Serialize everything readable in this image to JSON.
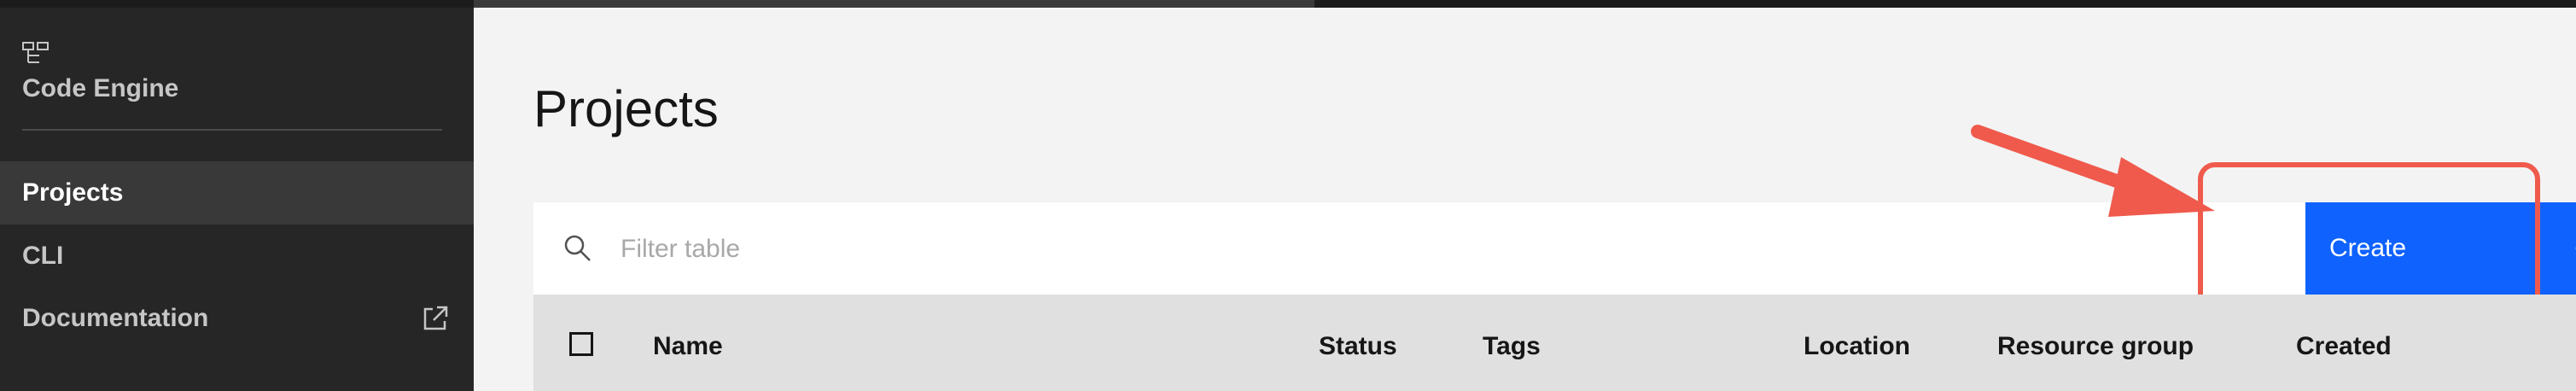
{
  "sidebar": {
    "app_icon": "code-engine-icon",
    "app_name": "Code Engine",
    "items": [
      {
        "label": "Projects",
        "active": true
      },
      {
        "label": "CLI",
        "active": false
      },
      {
        "label": "Documentation",
        "active": false,
        "icon": "external-link-icon"
      }
    ]
  },
  "main": {
    "title": "Projects",
    "search": {
      "placeholder": "Filter table",
      "icon": "search-icon"
    },
    "create_button": {
      "label": "Create",
      "icon": "plus"
    },
    "table": {
      "columns": [
        "Name",
        "Status",
        "Tags",
        "Location",
        "Resource group",
        "Created"
      ]
    }
  },
  "colors": {
    "sidebar_bg": "#262626",
    "active_item_bg": "#393939",
    "primary": "#0f62fe",
    "annotation": "#ef5a4c"
  }
}
